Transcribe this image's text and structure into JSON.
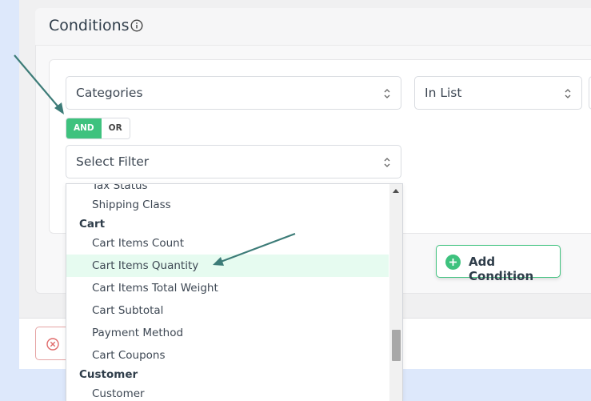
{
  "conditions": {
    "title": "Conditions",
    "filter_select": "Categories",
    "operator_select": "In List",
    "logic": {
      "and_label": "AND",
      "or_label": "OR",
      "selected": "AND"
    },
    "new_filter_select": "Select Filter"
  },
  "dropdown": {
    "partial_top_item": "Tax Status",
    "items": [
      {
        "label": "Shipping Class"
      },
      {
        "group": "Cart"
      },
      {
        "label": "Cart Items Count"
      },
      {
        "label": "Cart Items Quantity",
        "highlighted": true
      },
      {
        "label": "Cart Items Total Weight"
      },
      {
        "label": "Cart Subtotal"
      },
      {
        "label": "Payment Method"
      },
      {
        "label": "Cart Coupons"
      },
      {
        "group": "Customer"
      },
      {
        "label": "Customer"
      }
    ]
  },
  "add_condition": {
    "label": "Add Condition"
  },
  "colors": {
    "accent": "#3ec27e",
    "annotation_arrow": "#3d7c78",
    "highlight": "#e6fbf0",
    "danger": "#e06a6a"
  },
  "icons": {
    "info": "info-icon",
    "chevron": "chevron-updown-icon",
    "plus": "plus-circle-icon",
    "cancel": "close-circle-icon"
  }
}
